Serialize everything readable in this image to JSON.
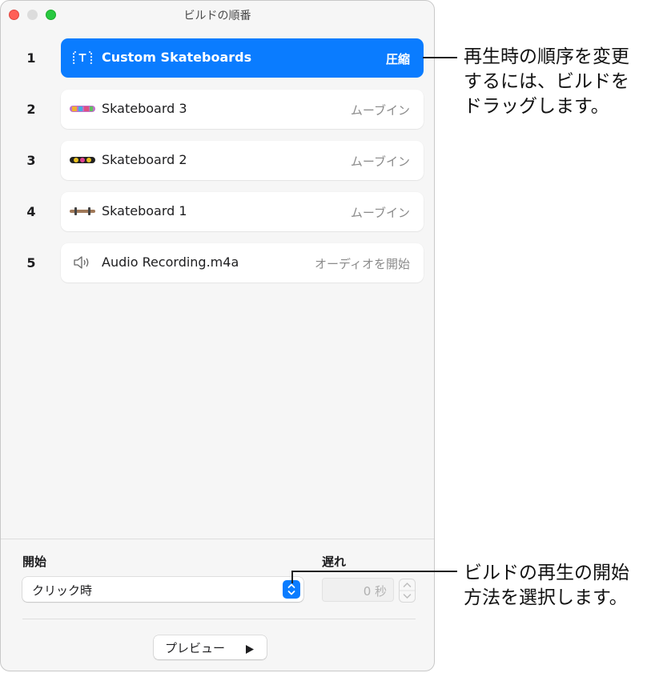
{
  "window": {
    "title": "ビルドの順番"
  },
  "builds": [
    {
      "number": "1",
      "icon": "text-box-icon",
      "label": "Custom Skateboards",
      "effect": "圧縮",
      "selected": true
    },
    {
      "number": "2",
      "icon": "skateboard-3-thumbnail",
      "label": "Skateboard 3",
      "effect": "ムーブイン",
      "selected": false
    },
    {
      "number": "3",
      "icon": "skateboard-2-thumbnail",
      "label": "Skateboard 2",
      "effect": "ムーブイン",
      "selected": false
    },
    {
      "number": "4",
      "icon": "skateboard-1-thumbnail",
      "label": "Skateboard 1",
      "effect": "ムーブイン",
      "selected": false
    },
    {
      "number": "5",
      "icon": "speaker-icon",
      "label": "Audio Recording.m4a",
      "effect": "オーディオを開始",
      "selected": false
    }
  ],
  "start": {
    "label": "開始",
    "value": "クリック時"
  },
  "delay": {
    "label": "遅れ",
    "value": "0 秒"
  },
  "preview": {
    "label": "プレビュー"
  },
  "callouts": {
    "reorder": [
      "再生時の順序を変更",
      "するには、ビルドを",
      "ドラッグします。"
    ],
    "start_method": [
      "ビルドの再生の開始",
      "方法を選択します。"
    ]
  },
  "colors": {
    "accent": "#0a7cff",
    "close": "#ff5f57",
    "zoom": "#28c840"
  }
}
